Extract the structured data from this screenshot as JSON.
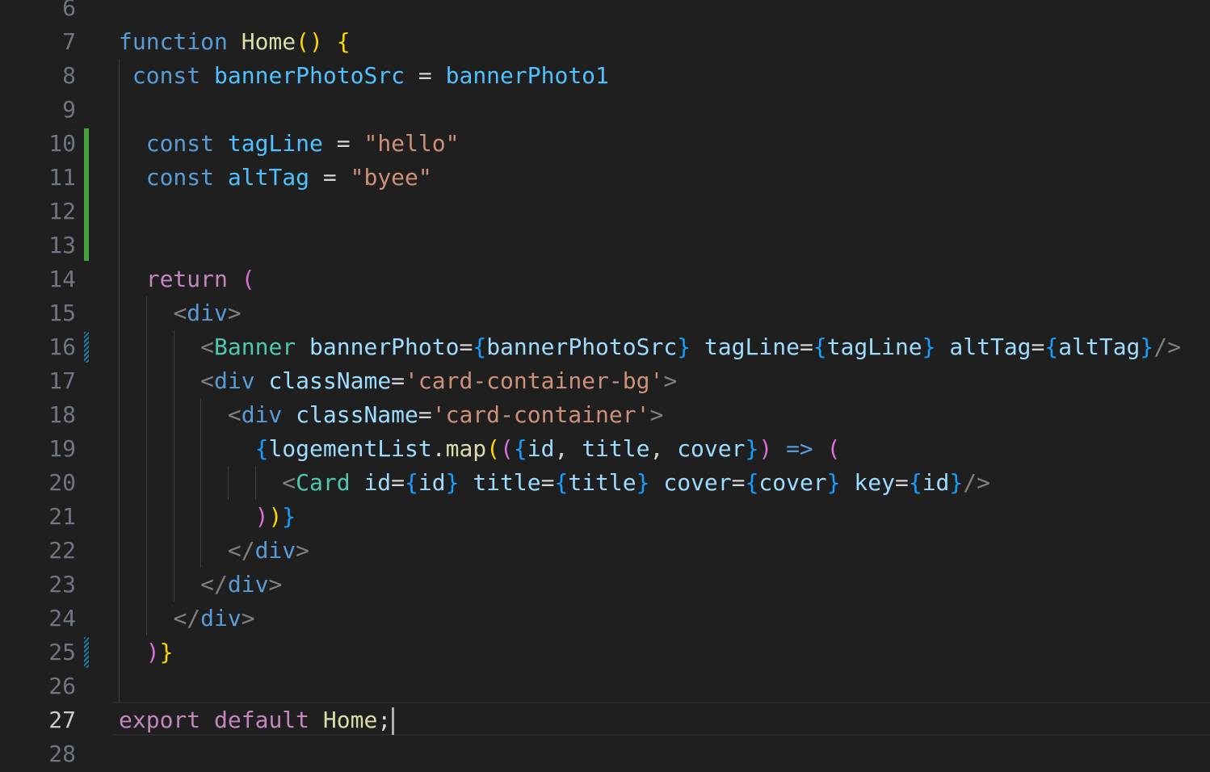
{
  "editor": {
    "language": "javascript-react",
    "current_line": 27,
    "colors": {
      "background": "#1f1f1f",
      "line_number": "#6e7681",
      "line_number_active": "#cccccc",
      "diff_added": "#48a13f",
      "diff_modified": "#1b81a8"
    },
    "gutter": {
      "added_lines": [
        10,
        11,
        12,
        13
      ],
      "modified_lines": [
        16,
        25
      ]
    },
    "lines": [
      {
        "num": "6",
        "tokens": []
      },
      {
        "num": "7",
        "tokens": [
          {
            "t": "function",
            "c": "kw"
          },
          {
            "t": " ",
            "c": "op"
          },
          {
            "t": "Home",
            "c": "fn"
          },
          {
            "t": "()",
            "c": "b1"
          },
          {
            "t": " ",
            "c": "op"
          },
          {
            "t": "{",
            "c": "b1"
          }
        ]
      },
      {
        "num": "8",
        "tokens": [
          {
            "t": " ",
            "c": "op"
          },
          {
            "t": "const",
            "c": "kw"
          },
          {
            "t": " ",
            "c": "op"
          },
          {
            "t": "bannerPhotoSrc",
            "c": "cst"
          },
          {
            "t": " = ",
            "c": "op"
          },
          {
            "t": "bannerPhoto1",
            "c": "cst"
          }
        ]
      },
      {
        "num": "9",
        "tokens": []
      },
      {
        "num": "10",
        "tokens": [
          {
            "t": "  ",
            "c": "op"
          },
          {
            "t": "const",
            "c": "kw"
          },
          {
            "t": " ",
            "c": "op"
          },
          {
            "t": "tagLine",
            "c": "cst"
          },
          {
            "t": " = ",
            "c": "op"
          },
          {
            "t": "\"hello\"",
            "c": "str"
          }
        ]
      },
      {
        "num": "11",
        "tokens": [
          {
            "t": "  ",
            "c": "op"
          },
          {
            "t": "const",
            "c": "kw"
          },
          {
            "t": " ",
            "c": "op"
          },
          {
            "t": "altTag",
            "c": "cst"
          },
          {
            "t": " = ",
            "c": "op"
          },
          {
            "t": "\"byee\"",
            "c": "str"
          }
        ]
      },
      {
        "num": "12",
        "tokens": []
      },
      {
        "num": "13",
        "tokens": []
      },
      {
        "num": "14",
        "tokens": [
          {
            "t": "  ",
            "c": "op"
          },
          {
            "t": "return",
            "c": "kwc"
          },
          {
            "t": " ",
            "c": "op"
          },
          {
            "t": "(",
            "c": "b2"
          }
        ]
      },
      {
        "num": "15",
        "tokens": [
          {
            "t": "    ",
            "c": "op"
          },
          {
            "t": "<",
            "c": "punc"
          },
          {
            "t": "div",
            "c": "tag"
          },
          {
            "t": ">",
            "c": "punc"
          }
        ]
      },
      {
        "num": "16",
        "tokens": [
          {
            "t": "      ",
            "c": "op"
          },
          {
            "t": "<",
            "c": "punc"
          },
          {
            "t": "Banner",
            "c": "comp"
          },
          {
            "t": " ",
            "c": "op"
          },
          {
            "t": "bannerPhoto",
            "c": "attr"
          },
          {
            "t": "=",
            "c": "op"
          },
          {
            "t": "{",
            "c": "b3"
          },
          {
            "t": "bannerPhotoSrc",
            "c": "var"
          },
          {
            "t": "}",
            "c": "b3"
          },
          {
            "t": " ",
            "c": "op"
          },
          {
            "t": "tagLine",
            "c": "attr"
          },
          {
            "t": "=",
            "c": "op"
          },
          {
            "t": "{",
            "c": "b3"
          },
          {
            "t": "tagLine",
            "c": "var"
          },
          {
            "t": "}",
            "c": "b3"
          },
          {
            "t": " ",
            "c": "op"
          },
          {
            "t": "altTag",
            "c": "attr"
          },
          {
            "t": "=",
            "c": "op"
          },
          {
            "t": "{",
            "c": "b3"
          },
          {
            "t": "altTag",
            "c": "var"
          },
          {
            "t": "}",
            "c": "b3"
          },
          {
            "t": "/>",
            "c": "punc"
          }
        ]
      },
      {
        "num": "17",
        "tokens": [
          {
            "t": "      ",
            "c": "op"
          },
          {
            "t": "<",
            "c": "punc"
          },
          {
            "t": "div",
            "c": "tag"
          },
          {
            "t": " ",
            "c": "op"
          },
          {
            "t": "className",
            "c": "attr"
          },
          {
            "t": "=",
            "c": "op"
          },
          {
            "t": "'card-container-bg'",
            "c": "str"
          },
          {
            "t": ">",
            "c": "punc"
          }
        ]
      },
      {
        "num": "18",
        "tokens": [
          {
            "t": "        ",
            "c": "op"
          },
          {
            "t": "<",
            "c": "punc"
          },
          {
            "t": "div",
            "c": "tag"
          },
          {
            "t": " ",
            "c": "op"
          },
          {
            "t": "className",
            "c": "attr"
          },
          {
            "t": "=",
            "c": "op"
          },
          {
            "t": "'card-container'",
            "c": "str"
          },
          {
            "t": ">",
            "c": "punc"
          }
        ]
      },
      {
        "num": "19",
        "tokens": [
          {
            "t": "          ",
            "c": "op"
          },
          {
            "t": "{",
            "c": "b3"
          },
          {
            "t": "logementList",
            "c": "var"
          },
          {
            "t": ".",
            "c": "op"
          },
          {
            "t": "map",
            "c": "fn"
          },
          {
            "t": "(",
            "c": "b1"
          },
          {
            "t": "(",
            "c": "b2"
          },
          {
            "t": "{",
            "c": "b3"
          },
          {
            "t": "id",
            "c": "var"
          },
          {
            "t": ", ",
            "c": "op"
          },
          {
            "t": "title",
            "c": "var"
          },
          {
            "t": ", ",
            "c": "op"
          },
          {
            "t": "cover",
            "c": "var"
          },
          {
            "t": "}",
            "c": "b3"
          },
          {
            "t": ")",
            "c": "b2"
          },
          {
            "t": " ",
            "c": "op"
          },
          {
            "t": "=>",
            "c": "kw"
          },
          {
            "t": " ",
            "c": "op"
          },
          {
            "t": "(",
            "c": "b2"
          }
        ]
      },
      {
        "num": "20",
        "tokens": [
          {
            "t": "            ",
            "c": "op"
          },
          {
            "t": "<",
            "c": "punc"
          },
          {
            "t": "Card",
            "c": "comp"
          },
          {
            "t": " ",
            "c": "op"
          },
          {
            "t": "id",
            "c": "attr"
          },
          {
            "t": "=",
            "c": "op"
          },
          {
            "t": "{",
            "c": "b3"
          },
          {
            "t": "id",
            "c": "var"
          },
          {
            "t": "}",
            "c": "b3"
          },
          {
            "t": " ",
            "c": "op"
          },
          {
            "t": "title",
            "c": "attr"
          },
          {
            "t": "=",
            "c": "op"
          },
          {
            "t": "{",
            "c": "b3"
          },
          {
            "t": "title",
            "c": "var"
          },
          {
            "t": "}",
            "c": "b3"
          },
          {
            "t": " ",
            "c": "op"
          },
          {
            "t": "cover",
            "c": "attr"
          },
          {
            "t": "=",
            "c": "op"
          },
          {
            "t": "{",
            "c": "b3"
          },
          {
            "t": "cover",
            "c": "var"
          },
          {
            "t": "}",
            "c": "b3"
          },
          {
            "t": " ",
            "c": "op"
          },
          {
            "t": "key",
            "c": "attr"
          },
          {
            "t": "=",
            "c": "op"
          },
          {
            "t": "{",
            "c": "b3"
          },
          {
            "t": "id",
            "c": "var"
          },
          {
            "t": "}",
            "c": "b3"
          },
          {
            "t": "/>",
            "c": "punc"
          }
        ]
      },
      {
        "num": "21",
        "tokens": [
          {
            "t": "          ",
            "c": "op"
          },
          {
            "t": ")",
            "c": "b2"
          },
          {
            "t": ")",
            "c": "b1"
          },
          {
            "t": "}",
            "c": "b3"
          }
        ]
      },
      {
        "num": "22",
        "tokens": [
          {
            "t": "        ",
            "c": "op"
          },
          {
            "t": "</",
            "c": "punc"
          },
          {
            "t": "div",
            "c": "tag"
          },
          {
            "t": ">",
            "c": "punc"
          }
        ]
      },
      {
        "num": "23",
        "tokens": [
          {
            "t": "      ",
            "c": "op"
          },
          {
            "t": "</",
            "c": "punc"
          },
          {
            "t": "div",
            "c": "tag"
          },
          {
            "t": ">",
            "c": "punc"
          }
        ]
      },
      {
        "num": "24",
        "tokens": [
          {
            "t": "    ",
            "c": "op"
          },
          {
            "t": "</",
            "c": "punc"
          },
          {
            "t": "div",
            "c": "tag"
          },
          {
            "t": ">",
            "c": "punc"
          }
        ]
      },
      {
        "num": "25",
        "tokens": [
          {
            "t": "  ",
            "c": "op"
          },
          {
            "t": ")",
            "c": "b2"
          },
          {
            "t": "}",
            "c": "b1"
          }
        ]
      },
      {
        "num": "26",
        "tokens": []
      },
      {
        "num": "27",
        "tokens": [
          {
            "t": "export",
            "c": "kwc"
          },
          {
            "t": " ",
            "c": "op"
          },
          {
            "t": "default",
            "c": "kwc"
          },
          {
            "t": " ",
            "c": "op"
          },
          {
            "t": "Home",
            "c": "fn"
          },
          {
            "t": ";",
            "c": "op"
          }
        ]
      },
      {
        "num": "28",
        "tokens": []
      }
    ]
  }
}
